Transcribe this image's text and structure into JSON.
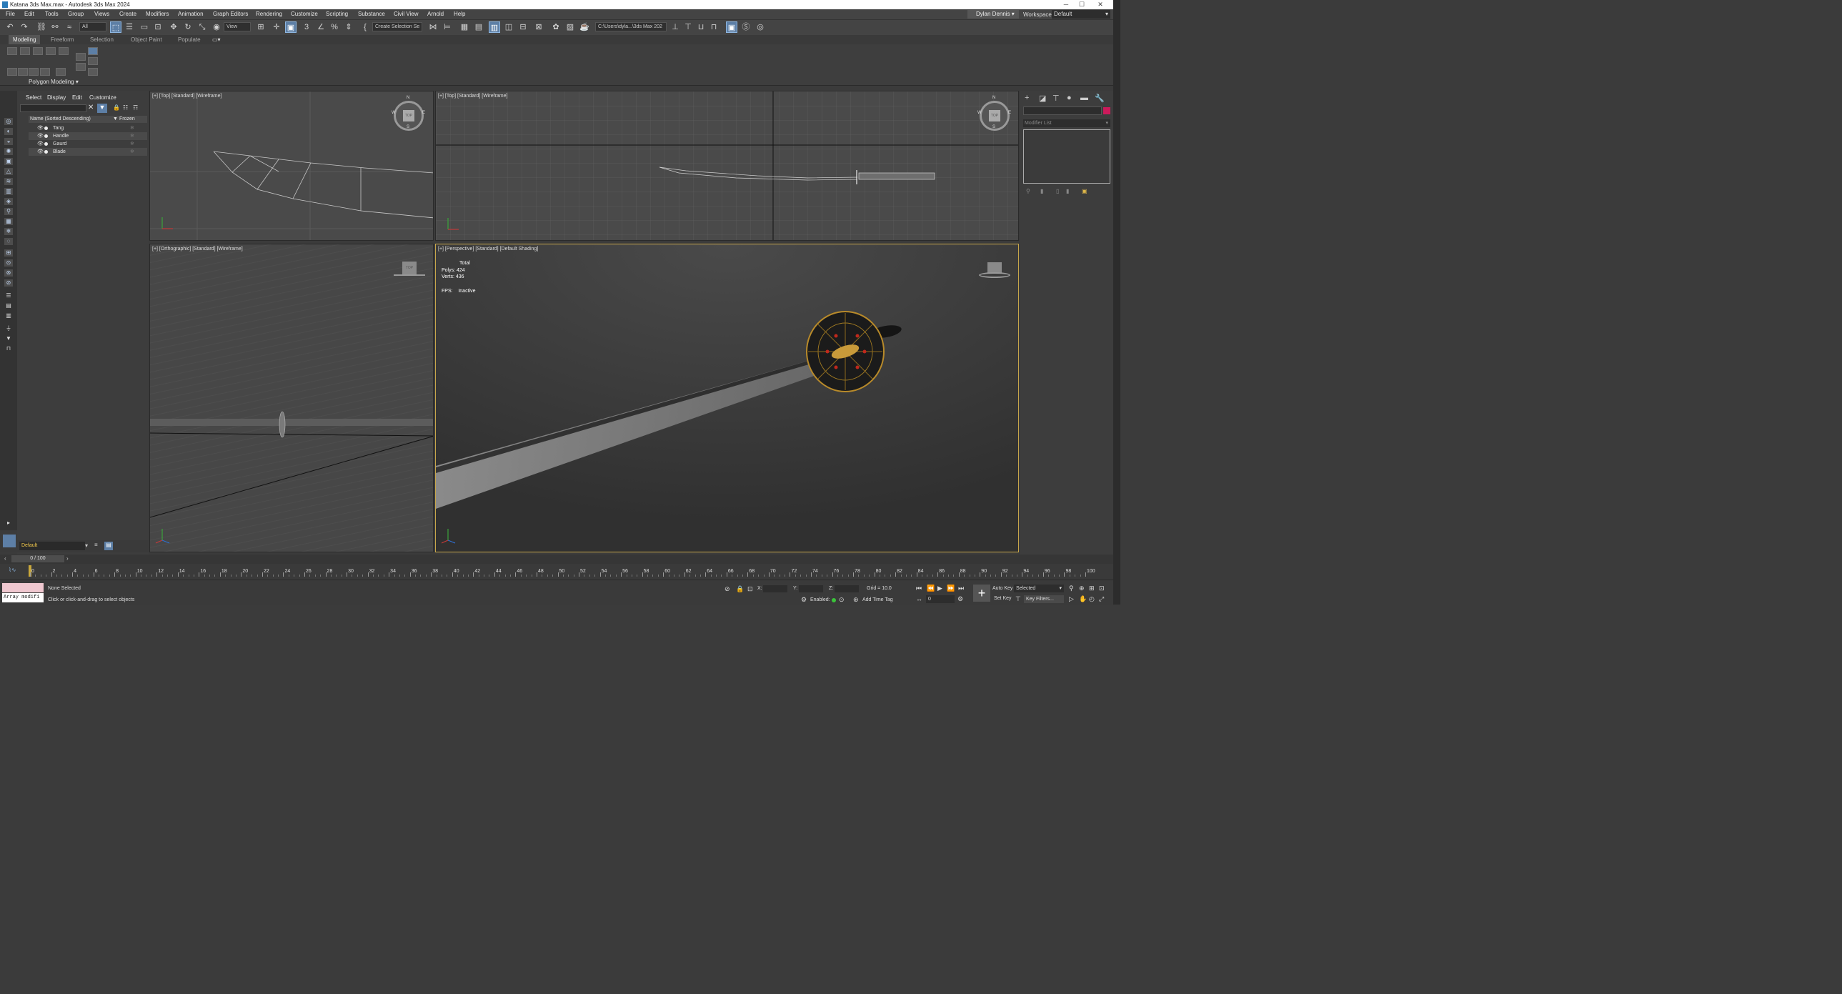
{
  "window": {
    "title": "Katana 3ds Max.max - Autodesk 3ds Max 2024",
    "minimize": "─",
    "maximize": "☐",
    "close": "✕"
  },
  "menu": [
    "File",
    "Edit",
    "Tools",
    "Group",
    "Views",
    "Create",
    "Modifiers",
    "Animation",
    "Graph Editors",
    "Rendering",
    "Customize",
    "Scripting",
    "Substance",
    "Civil View",
    "Arnold",
    "Help"
  ],
  "account": {
    "user": "Dylan Dennis",
    "workspaces_label": "Workspaces:",
    "workspace": "Default"
  },
  "toolbar": {
    "filter": "All",
    "refcoord": "View",
    "selection_set": "Create Selection Se",
    "path": "C:\\Users\\dyla...\\3ds Max 202"
  },
  "ribbon": {
    "tabs": [
      "Modeling",
      "Freeform",
      "Selection",
      "Object Paint",
      "Populate"
    ],
    "active_tab": "Modeling",
    "panel_label": "Polygon Modeling"
  },
  "scene_explorer": {
    "menus": [
      "Select",
      "Display",
      "Edit",
      "Customize"
    ],
    "col_name": "Name (Sorted Descending)",
    "col_frozen": "Frozen",
    "objects": [
      "Tang",
      "Handle",
      "Gaurd",
      "Blade"
    ]
  },
  "viewports": {
    "top_left": "[+] [Top] [Standard] [Wireframe]",
    "top_right": "[+] [Top] [Standard] [Wireframe]",
    "bottom_left": "[+] [Orthographic] [Standard] [Wireframe]",
    "bottom_right": "[+] [Perspective] [Standard] [Default Shading]"
  },
  "viewcube": {
    "n": "N",
    "s": "S",
    "e": "E",
    "w": "W",
    "top": "TOP"
  },
  "stats": {
    "total_label": "Total",
    "polys_label": "Polys:",
    "polys": "424",
    "verts_label": "Verts:",
    "verts": "436",
    "fps_label": "FPS:",
    "fps": "Inactive"
  },
  "command_panel": {
    "modifier_list": "Modifier List"
  },
  "layer": {
    "name": "Default"
  },
  "time": {
    "slider": "0 / 100",
    "ticks": [
      "0",
      "2",
      "4",
      "6",
      "8",
      "10",
      "12",
      "14",
      "16",
      "18",
      "20",
      "22",
      "24",
      "26",
      "28",
      "30",
      "32",
      "34",
      "36",
      "38",
      "40",
      "42",
      "44",
      "46",
      "48",
      "50",
      "52",
      "54",
      "56",
      "58",
      "60",
      "62",
      "64",
      "66",
      "68",
      "70",
      "72",
      "74",
      "76",
      "78",
      "80",
      "82",
      "84",
      "86",
      "88",
      "90",
      "92",
      "94",
      "96",
      "98",
      "100"
    ]
  },
  "status": {
    "maxscript": "Array modifi",
    "selection": "None Selected",
    "prompt": "Click or click-and-drag to select objects",
    "x_label": "X:",
    "y_label": "Y:",
    "z_label": "Z:",
    "grid": "Grid = 10.0",
    "enabled": "Enabled:",
    "add_time_tag": "Add Time Tag",
    "auto_key": "Auto Key",
    "set_key": "Set Key",
    "key_mode": "Selected",
    "key_filters": "Key Filters...",
    "frame": "0"
  }
}
